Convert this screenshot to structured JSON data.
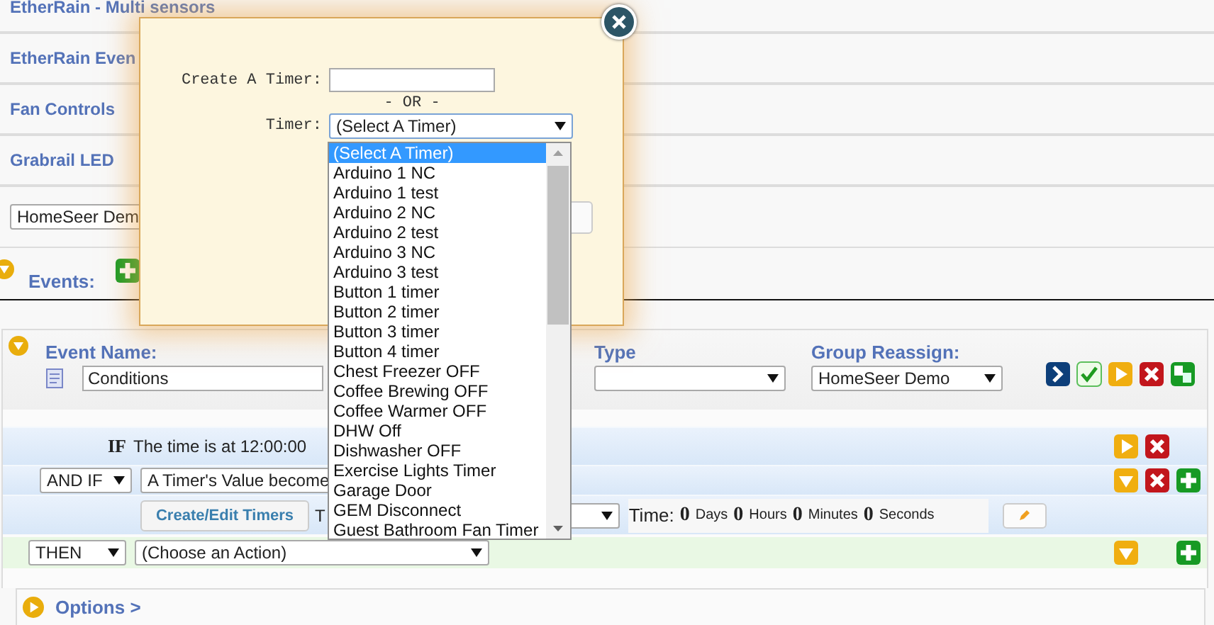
{
  "groups": [
    {
      "label": "EtherRain - Multi sensors"
    },
    {
      "label": "EtherRain Even"
    },
    {
      "label": "Fan Controls"
    },
    {
      "label": "Grabrail LED"
    }
  ],
  "group_select": {
    "value": "HomeSeer Dem"
  },
  "events": {
    "label": "Events:",
    "expanded": true
  },
  "event": {
    "expanded": true,
    "name_label": "Event Name:",
    "name": "Conditions",
    "type_label": "Type",
    "group_label": "Group Reassign:",
    "group_value": "HomeSeer Demo",
    "actions": [
      {
        "kind": "run"
      },
      {
        "kind": "check"
      },
      {
        "kind": "play"
      },
      {
        "kind": "delete"
      },
      {
        "kind": "copy"
      }
    ],
    "if_row": {
      "keyword": "IF",
      "text": "The time is at 12:00:00",
      "actions": [
        {
          "kind": "play"
        },
        {
          "kind": "delete"
        }
      ]
    },
    "and_row": {
      "operator": "AND IF",
      "condition": "A Timer's Value become",
      "actions": [
        {
          "kind": "collapse"
        },
        {
          "kind": "delete"
        },
        {
          "kind": "add"
        }
      ],
      "button": "Create/Edit Timers",
      "timer_prefix": "T",
      "time_label": "Time:",
      "time_parts": [
        {
          "value": "0",
          "unit": "Days"
        },
        {
          "value": "0",
          "unit": "Hours"
        },
        {
          "value": "0",
          "unit": "Minutes"
        },
        {
          "value": "0",
          "unit": "Seconds"
        }
      ]
    },
    "then_row": {
      "operator": "THEN",
      "action": "(Choose an Action)",
      "actions": [
        {
          "kind": "collapse"
        },
        {
          "kind": "add"
        }
      ]
    }
  },
  "options": {
    "label": "Options >",
    "expanded": false
  },
  "dialog": {
    "create_label": "Create A Timer:",
    "or_text": "- OR -",
    "timer_label": "Timer:",
    "timer_value": "(Select A Timer)",
    "timer_options": [
      {
        "label": "(Select A Timer)",
        "selected": true
      },
      {
        "label": "Arduino 1 NC",
        "selected": false
      },
      {
        "label": "Arduino 1 test",
        "selected": false
      },
      {
        "label": "Arduino 2 NC",
        "selected": false
      },
      {
        "label": "Arduino 2 test",
        "selected": false
      },
      {
        "label": "Arduino 3 NC",
        "selected": false
      },
      {
        "label": "Arduino 3 test",
        "selected": false
      },
      {
        "label": "Button 1 timer",
        "selected": false
      },
      {
        "label": "Button 2 timer",
        "selected": false
      },
      {
        "label": "Button 3 timer",
        "selected": false
      },
      {
        "label": "Button 4 timer",
        "selected": false
      },
      {
        "label": "Chest Freezer OFF",
        "selected": false
      },
      {
        "label": "Coffee Brewing OFF",
        "selected": false
      },
      {
        "label": "Coffee Warmer OFF",
        "selected": false
      },
      {
        "label": "DHW Off",
        "selected": false
      },
      {
        "label": "Dishwasher OFF",
        "selected": false
      },
      {
        "label": "Exercise Lights Timer",
        "selected": false
      },
      {
        "label": "Garage Door",
        "selected": false
      },
      {
        "label": "GEM Disconnect",
        "selected": false
      },
      {
        "label": "Guest Bathroom Fan Timer",
        "selected": false
      }
    ]
  }
}
